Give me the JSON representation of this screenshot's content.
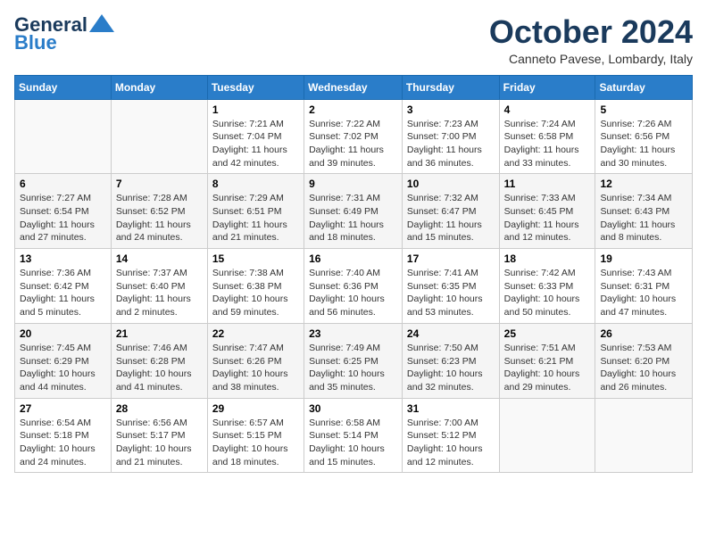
{
  "logo": {
    "line1": "General",
    "line2": "Blue"
  },
  "header": {
    "month": "October 2024",
    "location": "Canneto Pavese, Lombardy, Italy"
  },
  "weekdays": [
    "Sunday",
    "Monday",
    "Tuesday",
    "Wednesday",
    "Thursday",
    "Friday",
    "Saturday"
  ],
  "weeks": [
    [
      {
        "day": "",
        "info": ""
      },
      {
        "day": "",
        "info": ""
      },
      {
        "day": "1",
        "info": "Sunrise: 7:21 AM\nSunset: 7:04 PM\nDaylight: 11 hours and 42 minutes."
      },
      {
        "day": "2",
        "info": "Sunrise: 7:22 AM\nSunset: 7:02 PM\nDaylight: 11 hours and 39 minutes."
      },
      {
        "day": "3",
        "info": "Sunrise: 7:23 AM\nSunset: 7:00 PM\nDaylight: 11 hours and 36 minutes."
      },
      {
        "day": "4",
        "info": "Sunrise: 7:24 AM\nSunset: 6:58 PM\nDaylight: 11 hours and 33 minutes."
      },
      {
        "day": "5",
        "info": "Sunrise: 7:26 AM\nSunset: 6:56 PM\nDaylight: 11 hours and 30 minutes."
      }
    ],
    [
      {
        "day": "6",
        "info": "Sunrise: 7:27 AM\nSunset: 6:54 PM\nDaylight: 11 hours and 27 minutes."
      },
      {
        "day": "7",
        "info": "Sunrise: 7:28 AM\nSunset: 6:52 PM\nDaylight: 11 hours and 24 minutes."
      },
      {
        "day": "8",
        "info": "Sunrise: 7:29 AM\nSunset: 6:51 PM\nDaylight: 11 hours and 21 minutes."
      },
      {
        "day": "9",
        "info": "Sunrise: 7:31 AM\nSunset: 6:49 PM\nDaylight: 11 hours and 18 minutes."
      },
      {
        "day": "10",
        "info": "Sunrise: 7:32 AM\nSunset: 6:47 PM\nDaylight: 11 hours and 15 minutes."
      },
      {
        "day": "11",
        "info": "Sunrise: 7:33 AM\nSunset: 6:45 PM\nDaylight: 11 hours and 12 minutes."
      },
      {
        "day": "12",
        "info": "Sunrise: 7:34 AM\nSunset: 6:43 PM\nDaylight: 11 hours and 8 minutes."
      }
    ],
    [
      {
        "day": "13",
        "info": "Sunrise: 7:36 AM\nSunset: 6:42 PM\nDaylight: 11 hours and 5 minutes."
      },
      {
        "day": "14",
        "info": "Sunrise: 7:37 AM\nSunset: 6:40 PM\nDaylight: 11 hours and 2 minutes."
      },
      {
        "day": "15",
        "info": "Sunrise: 7:38 AM\nSunset: 6:38 PM\nDaylight: 10 hours and 59 minutes."
      },
      {
        "day": "16",
        "info": "Sunrise: 7:40 AM\nSunset: 6:36 PM\nDaylight: 10 hours and 56 minutes."
      },
      {
        "day": "17",
        "info": "Sunrise: 7:41 AM\nSunset: 6:35 PM\nDaylight: 10 hours and 53 minutes."
      },
      {
        "day": "18",
        "info": "Sunrise: 7:42 AM\nSunset: 6:33 PM\nDaylight: 10 hours and 50 minutes."
      },
      {
        "day": "19",
        "info": "Sunrise: 7:43 AM\nSunset: 6:31 PM\nDaylight: 10 hours and 47 minutes."
      }
    ],
    [
      {
        "day": "20",
        "info": "Sunrise: 7:45 AM\nSunset: 6:29 PM\nDaylight: 10 hours and 44 minutes."
      },
      {
        "day": "21",
        "info": "Sunrise: 7:46 AM\nSunset: 6:28 PM\nDaylight: 10 hours and 41 minutes."
      },
      {
        "day": "22",
        "info": "Sunrise: 7:47 AM\nSunset: 6:26 PM\nDaylight: 10 hours and 38 minutes."
      },
      {
        "day": "23",
        "info": "Sunrise: 7:49 AM\nSunset: 6:25 PM\nDaylight: 10 hours and 35 minutes."
      },
      {
        "day": "24",
        "info": "Sunrise: 7:50 AM\nSunset: 6:23 PM\nDaylight: 10 hours and 32 minutes."
      },
      {
        "day": "25",
        "info": "Sunrise: 7:51 AM\nSunset: 6:21 PM\nDaylight: 10 hours and 29 minutes."
      },
      {
        "day": "26",
        "info": "Sunrise: 7:53 AM\nSunset: 6:20 PM\nDaylight: 10 hours and 26 minutes."
      }
    ],
    [
      {
        "day": "27",
        "info": "Sunrise: 6:54 AM\nSunset: 5:18 PM\nDaylight: 10 hours and 24 minutes."
      },
      {
        "day": "28",
        "info": "Sunrise: 6:56 AM\nSunset: 5:17 PM\nDaylight: 10 hours and 21 minutes."
      },
      {
        "day": "29",
        "info": "Sunrise: 6:57 AM\nSunset: 5:15 PM\nDaylight: 10 hours and 18 minutes."
      },
      {
        "day": "30",
        "info": "Sunrise: 6:58 AM\nSunset: 5:14 PM\nDaylight: 10 hours and 15 minutes."
      },
      {
        "day": "31",
        "info": "Sunrise: 7:00 AM\nSunset: 5:12 PM\nDaylight: 10 hours and 12 minutes."
      },
      {
        "day": "",
        "info": ""
      },
      {
        "day": "",
        "info": ""
      }
    ]
  ]
}
